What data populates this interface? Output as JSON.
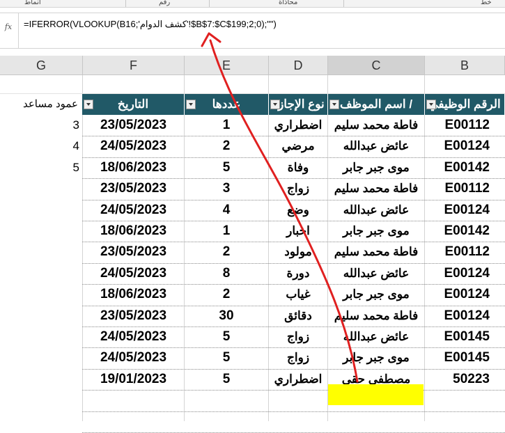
{
  "ribbon": {
    "labels": [
      "أنماط",
      "رقم",
      "محاذاة",
      "خط"
    ]
  },
  "formula_bar": {
    "fx_label": "fx",
    "formula": "=IFERROR(VLOOKUP(B16;'كشف الدوام'!$B$7:$C$199;2;0);\"\")"
  },
  "columns": [
    "G",
    "F",
    "E",
    "D",
    "C",
    "B"
  ],
  "table": {
    "headers": {
      "g": "عمود مساعد",
      "f": "التاريخ",
      "e": "عددها",
      "d": "نوع الإجازة",
      "c": "اسم الموظف /",
      "b": "الرقم الوظيفي"
    },
    "rows": [
      {
        "g": "3",
        "f": "23/05/2023",
        "e": "1",
        "d": "اضطراري",
        "c": "فاطة محمد سليم",
        "b": "E00112"
      },
      {
        "g": "4",
        "f": "24/05/2023",
        "e": "2",
        "d": "مرضي",
        "c": "عائض عبدالله",
        "b": "E00124"
      },
      {
        "g": "5",
        "f": "18/06/2023",
        "e": "5",
        "d": "وفاة",
        "c": "موى جبر جابر",
        "b": "E00142"
      },
      {
        "g": "",
        "f": "23/05/2023",
        "e": "3",
        "d": "زواج",
        "c": "فاطة محمد سليم",
        "b": "E00112"
      },
      {
        "g": "",
        "f": "24/05/2023",
        "e": "4",
        "d": "وضع",
        "c": "عائض عبدالله",
        "b": "E00124"
      },
      {
        "g": "",
        "f": "18/06/2023",
        "e": "1",
        "d": "اخبار",
        "c": "موى جبر جابر",
        "b": "E00142"
      },
      {
        "g": "",
        "f": "23/05/2023",
        "e": "2",
        "d": "مولود",
        "c": "فاطة محمد سليم",
        "b": "E00112"
      },
      {
        "g": "",
        "f": "24/05/2023",
        "e": "8",
        "d": "دورة",
        "c": "عائض عبدالله",
        "b": "E00124"
      },
      {
        "g": "",
        "f": "18/06/2023",
        "e": "2",
        "d": "غياب",
        "c": "موى جبر جابر",
        "b": "E00124"
      },
      {
        "g": "",
        "f": "23/05/2023",
        "e": "30",
        "d": "دقائق",
        "c": "فاطة محمد سليم",
        "b": "E00124"
      },
      {
        "g": "",
        "f": "24/05/2023",
        "e": "5",
        "d": "زواج",
        "c": "عائض عبدالله",
        "b": "E00145"
      },
      {
        "g": "",
        "f": "24/05/2023",
        "e": "5",
        "d": "زواج",
        "c": "موى جبر جابر",
        "b": "E00145"
      },
      {
        "g": "",
        "f": "19/01/2023",
        "e": "5",
        "d": "اضطراري",
        "c": "مصطفى حقي",
        "b": "50223"
      }
    ]
  },
  "colors": {
    "header_bg": "#215967",
    "highlight": "#ffff00",
    "arrow": "#e02020"
  }
}
